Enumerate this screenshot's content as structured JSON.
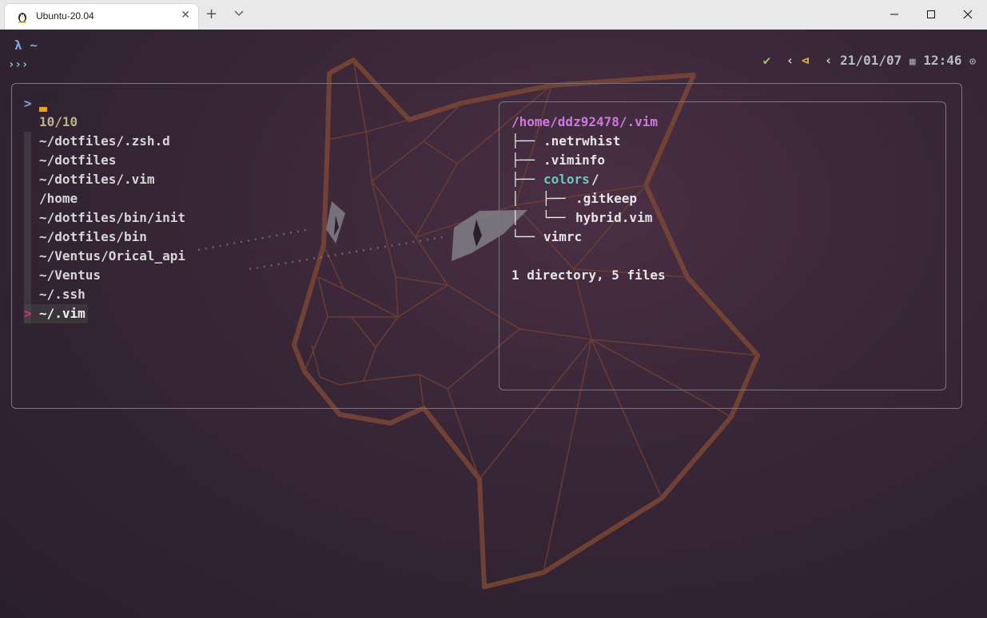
{
  "tab": {
    "title": "Ubuntu-20.04",
    "icon": "linux-tux-icon",
    "close": "✕"
  },
  "titlebar": {
    "new_tab": "+",
    "minimize": "minimize-icon",
    "maximize": "maximize-icon",
    "close": "close-icon"
  },
  "prompt": {
    "lambda_line": "λ ~",
    "arrows": "›››"
  },
  "status": {
    "check": "✔",
    "sep1": "‹",
    "git_icon": "⊲",
    "sep2": "‹",
    "date": "21/01/07",
    "calendar_icon": "▦",
    "time": "12:46",
    "clock_icon": "⊙"
  },
  "fzf": {
    "query_prompt": ">",
    "count": "10/10",
    "items": [
      "~/dotfiles/.zsh.d",
      "~/dotfiles",
      "~/dotfiles/.vim",
      "/home",
      "~/dotfiles/bin/init",
      "~/dotfiles/bin",
      "~/Ventus/Orical_api",
      "~/Ventus",
      "~/.ssh"
    ],
    "selected_marker": ">",
    "selected": "~/.vim"
  },
  "preview": {
    "path": "/home/ddz92478/.vim",
    "rows": [
      {
        "tree": "├── ",
        "name": ".netrwhist",
        "type": "file"
      },
      {
        "tree": "├── ",
        "name": ".viminfo",
        "type": "file"
      },
      {
        "tree": "├── ",
        "name": "colors",
        "suffix": "/",
        "type": "dir"
      },
      {
        "tree": "│   ├── ",
        "name": ".gitkeep",
        "type": "file"
      },
      {
        "tree": "│   └── ",
        "name": "hybrid.vim",
        "type": "file"
      },
      {
        "tree": "└── ",
        "name": "vimrc",
        "type": "file"
      }
    ],
    "summary": "1 directory, 5 files"
  },
  "colors": {
    "accent_orange": "#f0a11a",
    "selection_marker": "#e0306a",
    "path": "#cf79e0",
    "dir": "#6ec6c6"
  }
}
